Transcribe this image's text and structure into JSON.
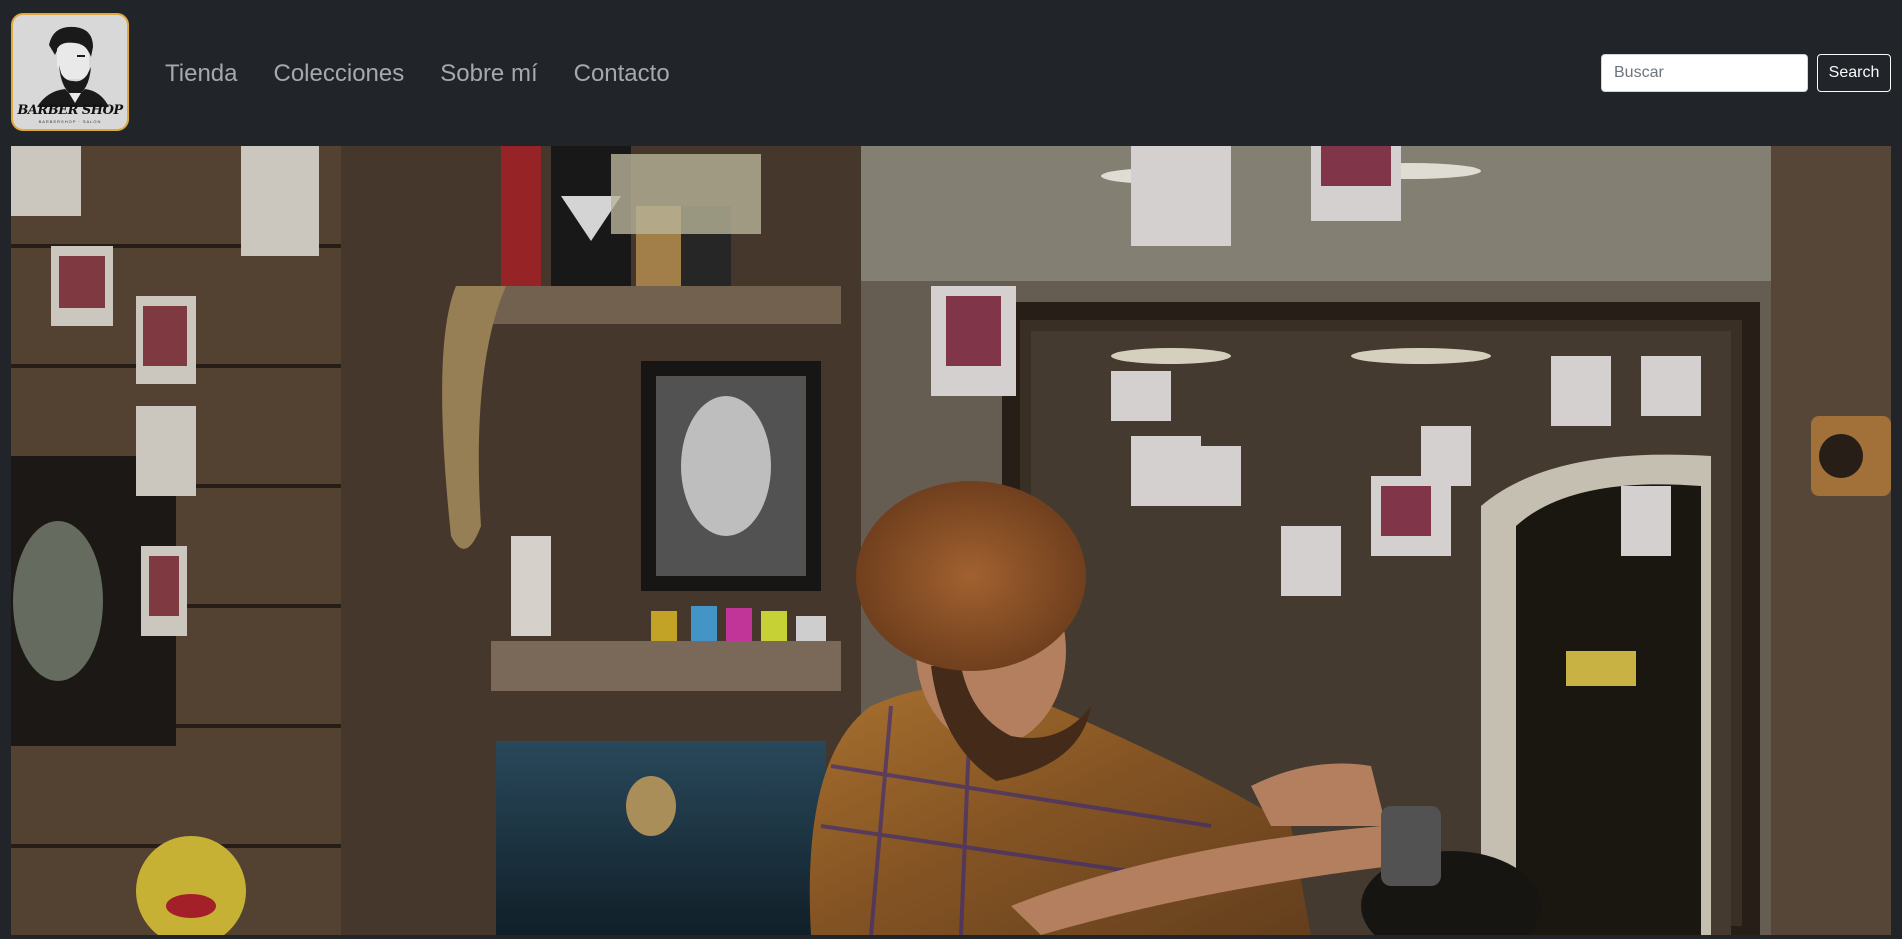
{
  "brand": {
    "logo_text": "BARBER SHOP",
    "logo_subtext": "BARBERSHOP · SALON",
    "accent_color": "#e0a93a"
  },
  "nav": {
    "links": [
      "Tienda",
      "Colecciones",
      "Sobre mí",
      "Contacto"
    ]
  },
  "search": {
    "placeholder": "Buscar",
    "value": "",
    "button_label": "Search"
  },
  "hero": {
    "icon": "barbershop-photo"
  }
}
